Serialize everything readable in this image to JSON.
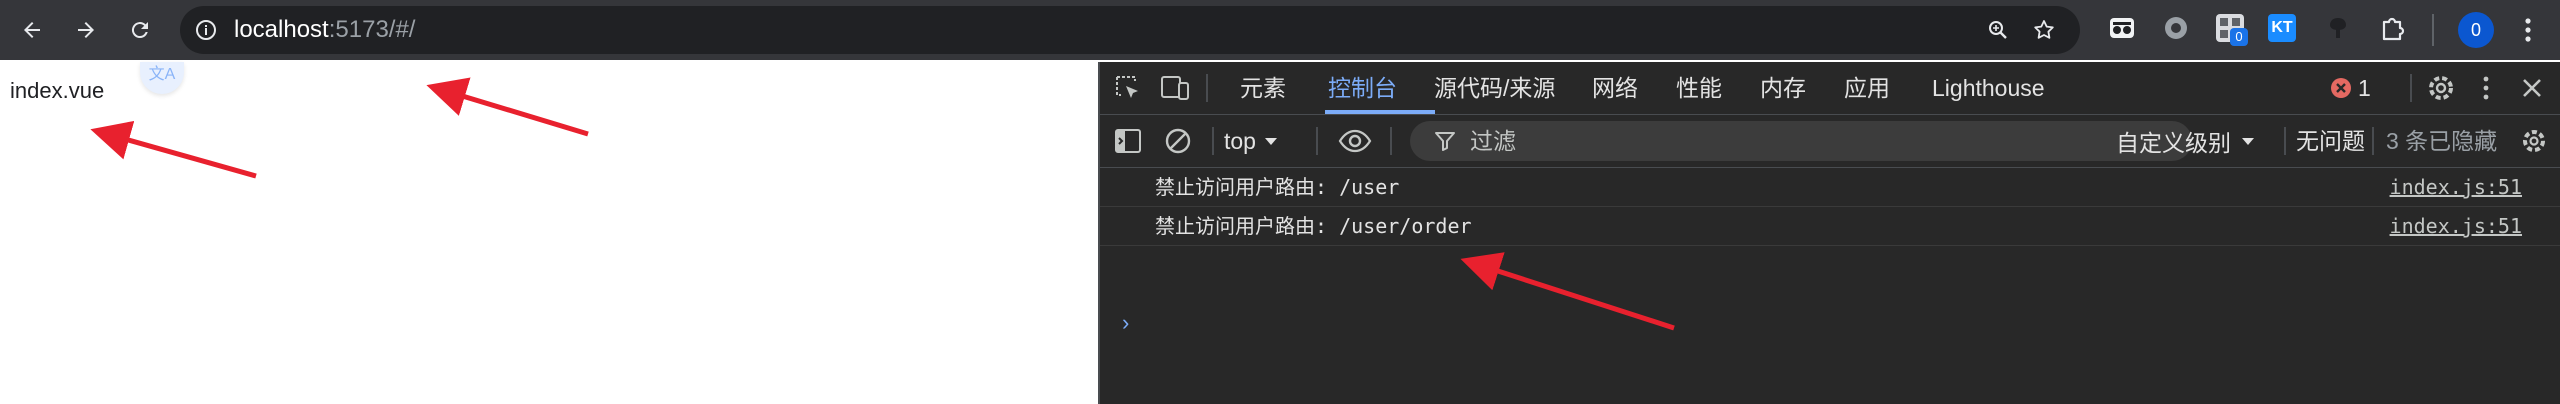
{
  "browser": {
    "url_host": "localhost",
    "url_rest": ":5173/#/",
    "profile_badge": "0",
    "ext_badge": "0",
    "ext_kt_label": "KT"
  },
  "page": {
    "text": "index.vue",
    "translate_glyph": "文A"
  },
  "devtools": {
    "tabs": [
      "元素",
      "控制台",
      "源代码/来源",
      "网络",
      "性能",
      "内存",
      "应用",
      "Lighthouse"
    ],
    "active_tab": "控制台",
    "error_count": "1",
    "context_label": "top",
    "filter_placeholder": "过滤",
    "level_label": "自定义级别",
    "issues_label": "无问题",
    "hidden_label": "3 条已隐藏",
    "logs": [
      {
        "message": "禁止访问用户路由: /user",
        "source": "index.js:51"
      },
      {
        "message": "禁止访问用户路由: /user/order",
        "source": "index.js:51"
      }
    ],
    "prompt_symbol": "›"
  },
  "colors": {
    "toolbar_bg": "#35363a",
    "devtools_bg": "#282828",
    "accent": "#7cacf8",
    "arrow": "#e8212e",
    "error": "#e46962"
  }
}
